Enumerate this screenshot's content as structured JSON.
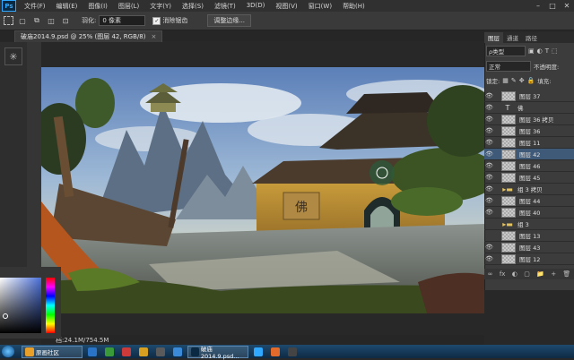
{
  "menu": {
    "app_logo": "Ps",
    "items": [
      "文件(F)",
      "编辑(E)",
      "图像(I)",
      "图层(L)",
      "文字(Y)",
      "选择(S)",
      "滤镜(T)",
      "3D(D)",
      "视图(V)",
      "窗口(W)",
      "帮助(H)"
    ],
    "window_controls": [
      "–",
      "□",
      "✕"
    ]
  },
  "options": {
    "feather_label": "羽化:",
    "feather_value": "0 像素",
    "antialias_label": "消除锯齿",
    "refine_edge_button": "调整边缘..."
  },
  "document": {
    "tab_title": "破庙2014.9.psd @ 25% (图层 42, RGB/8)",
    "close": "×"
  },
  "status": {
    "text": "档:24.1M/754.5M"
  },
  "layers_panel": {
    "tabs": [
      "图层",
      "通道",
      "路径"
    ],
    "filter_kind": "ρ类型",
    "blend_mode": "正常",
    "opacity_label": "不透明度:",
    "lock_label": "锁定:",
    "fill_label": "填充:",
    "layers": [
      {
        "name": "图层 37",
        "kind": "pixel",
        "visible": true,
        "selected": false
      },
      {
        "name": "佛",
        "kind": "text",
        "visible": true,
        "selected": false
      },
      {
        "name": "图层 36 拷贝",
        "kind": "pixel",
        "visible": true,
        "selected": false
      },
      {
        "name": "图层 36",
        "kind": "pixel",
        "visible": true,
        "selected": false
      },
      {
        "name": "图层 11",
        "kind": "pixel",
        "visible": true,
        "selected": false
      },
      {
        "name": "图层 42",
        "kind": "pixel",
        "visible": true,
        "selected": true
      },
      {
        "name": "图层 46",
        "kind": "pixel",
        "visible": true,
        "selected": false
      },
      {
        "name": "图层 45",
        "kind": "pixel",
        "visible": true,
        "selected": false
      },
      {
        "name": "组 3 拷贝",
        "kind": "group",
        "visible": true,
        "selected": false
      },
      {
        "name": "图层 44",
        "kind": "pixel",
        "visible": true,
        "selected": false
      },
      {
        "name": "图层 40",
        "kind": "pixel",
        "visible": true,
        "selected": false
      },
      {
        "name": "组 3",
        "kind": "group",
        "visible": false,
        "selected": false
      },
      {
        "name": "图层 13",
        "kind": "pixel",
        "visible": false,
        "selected": false
      },
      {
        "name": "图层 43",
        "kind": "pixel",
        "visible": true,
        "selected": false
      },
      {
        "name": "图层 12",
        "kind": "pixel",
        "visible": true,
        "selected": false
      }
    ],
    "bottom_icons": [
      "∞",
      "fx",
      "◐",
      "▢",
      "📁",
      "+",
      "🗑"
    ]
  },
  "taskbar": {
    "tasks": [
      {
        "label": "原画社区",
        "color": "#e8a02a"
      },
      {
        "label": "",
        "color": "#2a74c8"
      },
      {
        "label": "",
        "color": "#3a9a3a"
      },
      {
        "label": "",
        "color": "#cc3a3a"
      },
      {
        "label": "",
        "color": "#d8a020"
      },
      {
        "label": "",
        "color": "#5a5a5a"
      },
      {
        "label": "",
        "color": "#3a8ad8"
      },
      {
        "label": "破庙2014.9.psd...",
        "color": "#0a2a44"
      },
      {
        "label": "",
        "color": "#31a8ff"
      },
      {
        "label": "",
        "color": "#e26a2a"
      },
      {
        "label": "",
        "color": "#444"
      }
    ]
  },
  "colors": {
    "accent": "#31a8ff",
    "selected_layer": "#3f5a78"
  }
}
